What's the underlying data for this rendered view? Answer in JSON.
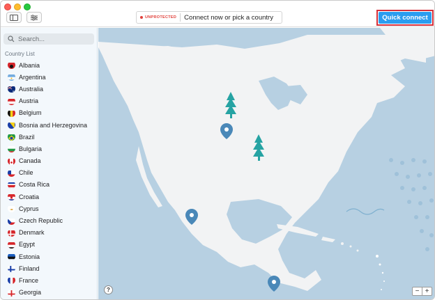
{
  "titlebar": {
    "status_tag": "UNPROTECTED",
    "status_text": "Connect now or pick a country",
    "quick_connect_label": "Quick connect"
  },
  "sidebar": {
    "search_placeholder": "Search...",
    "list_heading": "Country List",
    "countries": [
      {
        "name": "Albania",
        "flag": "albania"
      },
      {
        "name": "Argentina",
        "flag": "argentina"
      },
      {
        "name": "Australia",
        "flag": "australia"
      },
      {
        "name": "Austria",
        "flag": "austria"
      },
      {
        "name": "Belgium",
        "flag": "belgium"
      },
      {
        "name": "Bosnia and Herzegovina",
        "flag": "bosnia"
      },
      {
        "name": "Brazil",
        "flag": "brazil"
      },
      {
        "name": "Bulgaria",
        "flag": "bulgaria"
      },
      {
        "name": "Canada",
        "flag": "canada"
      },
      {
        "name": "Chile",
        "flag": "chile"
      },
      {
        "name": "Costa Rica",
        "flag": "costa-rica"
      },
      {
        "name": "Croatia",
        "flag": "croatia"
      },
      {
        "name": "Cyprus",
        "flag": "cyprus"
      },
      {
        "name": "Czech Republic",
        "flag": "czech"
      },
      {
        "name": "Denmark",
        "flag": "denmark"
      },
      {
        "name": "Egypt",
        "flag": "egypt"
      },
      {
        "name": "Estonia",
        "flag": "estonia"
      },
      {
        "name": "Finland",
        "flag": "finland"
      },
      {
        "name": "France",
        "flag": "france"
      },
      {
        "name": "Georgia",
        "flag": "georgia"
      }
    ]
  },
  "map": {
    "help_label": "?",
    "zoom_out_label": "−",
    "zoom_in_label": "+"
  },
  "colors": {
    "accent": "#2b9df0",
    "unprotected": "#e0403a",
    "highlight_border": "#d62f3a",
    "ocean": "#b7d0e2",
    "land": "#f2f3f4",
    "pin": "#4a88b8",
    "tree": "#26a3a3"
  }
}
